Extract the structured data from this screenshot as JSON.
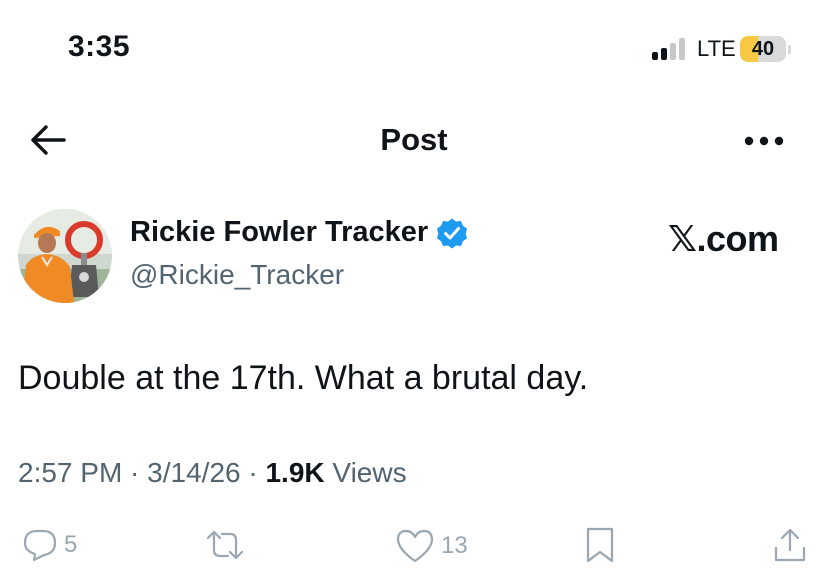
{
  "status_bar": {
    "time": "3:35",
    "network": "LTE",
    "battery_level": "40",
    "battery_fraction": 0.4,
    "battery_color": "#f6c844"
  },
  "header": {
    "title": "Post",
    "back_icon": "arrow-left-icon",
    "more_icon": "more-horizontal-icon"
  },
  "author": {
    "name": "Rickie Fowler Tracker",
    "handle": "@Rickie_Tracker",
    "verified_icon": "verified-badge-icon",
    "verified_color": "#1d9bf0"
  },
  "watermark": "𝕏.com",
  "post": {
    "text": "Double at the 17th. What a brutal day."
  },
  "meta": {
    "time": "2:57 PM",
    "sep1": " · ",
    "date": "3/14/26",
    "sep2": " · ",
    "views_count": "1.9K",
    "views_label": " Views"
  },
  "actions": {
    "reply_count": "5",
    "repost_count": "",
    "like_count": "13"
  }
}
